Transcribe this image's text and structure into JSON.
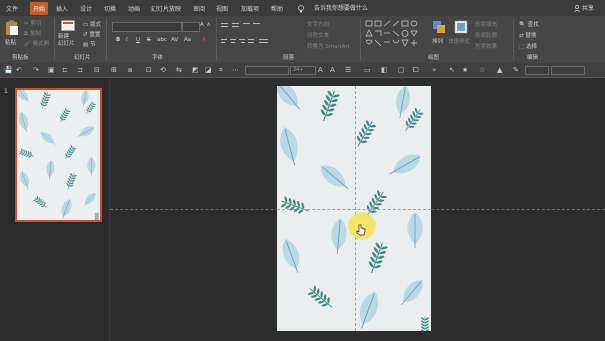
{
  "tabs": [
    {
      "label": "文件",
      "active": false
    },
    {
      "label": "开始",
      "active": true
    },
    {
      "label": "插入",
      "active": false
    },
    {
      "label": "设计",
      "active": false
    },
    {
      "label": "切换",
      "active": false
    },
    {
      "label": "动画",
      "active": false
    },
    {
      "label": "幻灯片放映",
      "active": false
    },
    {
      "label": "审阅",
      "active": false
    },
    {
      "label": "视图",
      "active": false
    },
    {
      "label": "加载项",
      "active": false
    },
    {
      "label": "帮助",
      "active": false
    }
  ],
  "tell_me": "告诉我你想要做什么",
  "share_label": "共享",
  "ribbon": {
    "clipboard": {
      "paste": "粘贴",
      "cut": "剪切",
      "copy": "复制",
      "format_painter": "格式刷",
      "group_label": "剪贴板"
    },
    "slides": {
      "new_slide": "新建\n幻灯片",
      "layout": "版式",
      "reset": "重置",
      "section": "节",
      "group_label": "幻灯片"
    },
    "font": {
      "group_label": "字体",
      "bold": "B",
      "italic": "I",
      "underline": "U",
      "strike": "S",
      "shadow": "abc",
      "spacing": "AV",
      "case": "Aa",
      "grow": "A",
      "shrink": "A",
      "clear": "A"
    },
    "paragraph": {
      "group_label": "段落",
      "text_direction": "文字方向",
      "align_text": "对齐文本",
      "smartart": "转换为 SmartArt"
    },
    "drawing": {
      "group_label": "绘图",
      "arrange": "排列",
      "quick_styles": "快速样式",
      "shape_fill": "形状填充",
      "shape_outline": "形状轮廓",
      "shape_effects": "形状效果"
    },
    "editing": {
      "group_label": "编辑",
      "find": "查找",
      "replace": "替换",
      "select": "选择"
    }
  },
  "qat": {
    "font_size_value": "24+"
  },
  "slide_panel": {
    "slide_number": "1"
  },
  "colors": {
    "accent": "#c75b2a",
    "thumb_border": "#d84b2a",
    "leaf": "#3e8a8a",
    "leaf_light": "#a9cfe0"
  },
  "cursor_icon": "hand-pointer-icon"
}
